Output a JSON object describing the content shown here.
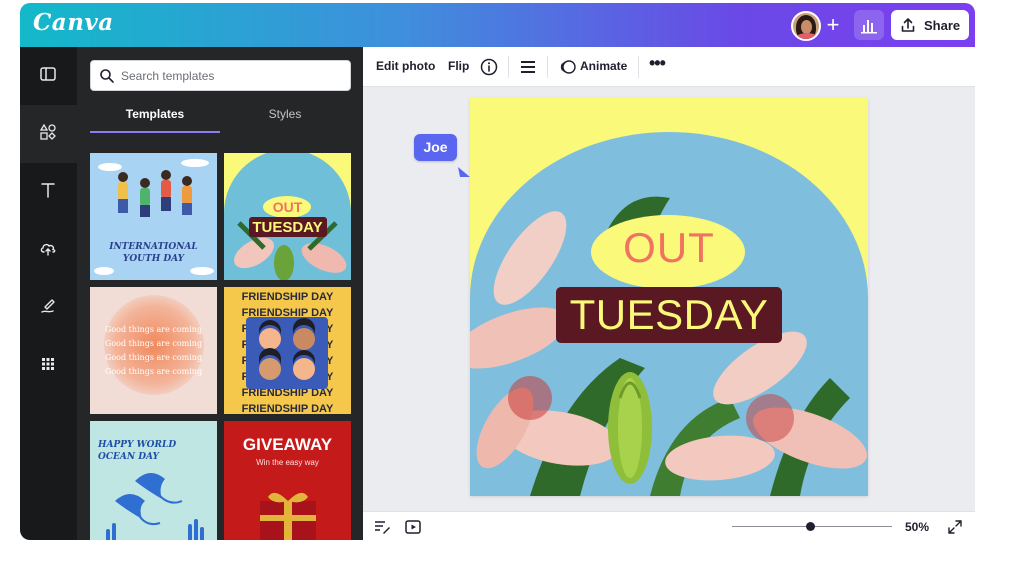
{
  "app": {
    "logo": "Canva"
  },
  "header": {
    "share_label": "Share"
  },
  "colors": {
    "accent": "#8b7df0",
    "cursor": "#5a66f0",
    "brand_gradient": [
      "#13b9c9",
      "#7b3ff0"
    ]
  },
  "rail": {
    "items": [
      {
        "name": "layout-icon",
        "active": false
      },
      {
        "name": "elements-icon",
        "active": true
      },
      {
        "name": "text-icon",
        "active": false
      },
      {
        "name": "upload-cloud-icon",
        "active": false
      },
      {
        "name": "draw-icon",
        "active": false
      },
      {
        "name": "apps-grid-icon",
        "active": false
      }
    ]
  },
  "panel": {
    "search_placeholder": "Search templates",
    "tabs": [
      {
        "label": "Templates",
        "active": true
      },
      {
        "label": "Styles",
        "active": false
      }
    ],
    "templates": [
      {
        "lines": [
          "INTERNATIONAL",
          "YOUTH DAY"
        ]
      },
      {
        "out": "OUT",
        "title": "TUESDAY"
      },
      {
        "repeated_text": "Good things are coming",
        "repeat_count": 4
      },
      {
        "repeated_text": "FRIENDSHIP DAY"
      },
      {
        "lines": [
          "HAPPY WORLD",
          "OCEAN DAY"
        ]
      },
      {
        "title": "GIVEAWAY",
        "subtitle": "Win the easy way"
      }
    ]
  },
  "toolbar": {
    "edit_photo": "Edit photo",
    "flip": "Flip",
    "animate": "Animate"
  },
  "design": {
    "out": "OUT",
    "title": "TUESDAY"
  },
  "collaborator": {
    "name": "Joe"
  },
  "zoom": {
    "label": "50%",
    "value": 50
  }
}
